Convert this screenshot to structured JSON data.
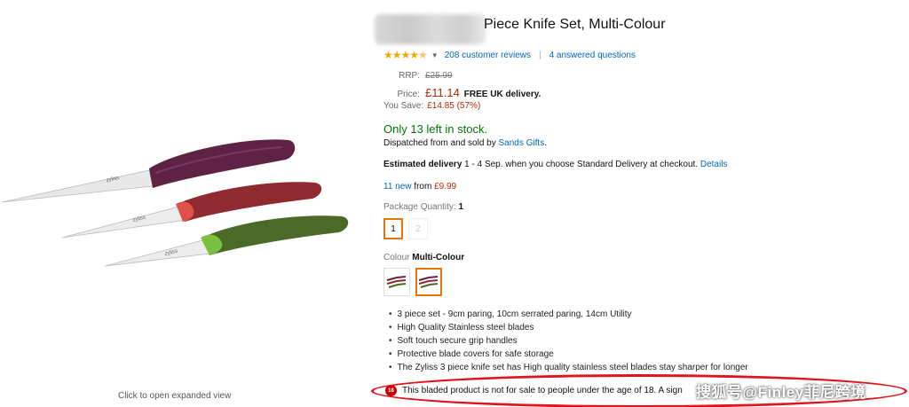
{
  "product": {
    "title": "Piece Knife Set, Multi-Colour",
    "rating": {
      "stars_value": 4.5,
      "reviews_label": "208 customer reviews",
      "questions_label": "4 answered questions"
    },
    "price": {
      "rrp_label": "RRP:",
      "rrp_value": "£25.99",
      "price_label": "Price:",
      "price_value": "£11.14",
      "delivery_note": "FREE UK delivery.",
      "save_label": "You Save:",
      "save_value": "£14.85 (57%)"
    },
    "stock": "Only 13 left in stock.",
    "dispatched_prefix": "Dispatched from and sold by",
    "seller": "Sands Gifts",
    "dispatched_suffix": ".",
    "delivery": {
      "label": "Estimated delivery",
      "text": " 1 - 4 Sep. when you choose Standard Delivery at checkout.",
      "details_link": "Details"
    },
    "offers": {
      "count_link": "11 new",
      "from_text": "from",
      "price": "£9.99"
    },
    "package_quantity": {
      "label": "Package Quantity:",
      "value": "1",
      "options": [
        "1",
        "2"
      ]
    },
    "colour": {
      "label": "Colour",
      "value": "Multi-Colour"
    },
    "bullets": [
      "3 piece set - 9cm paring, 10cm serrated paring, 14cm Utility",
      "High Quality Stainless steel blades",
      "Soft touch secure grip handles",
      "Protective blade covers for safe storage",
      "The Zyliss 3 piece knife set has High quality stainless steel blades stay sharper for longer"
    ],
    "warning": {
      "badge": "18",
      "text": "This bladed product is not for sale to people under the age of 18. A sign"
    },
    "expand_link": "Click to open expanded view",
    "knife_brand": "zyliss"
  },
  "watermark": "搜狐号@Finley菲尼跨境",
  "colors": {
    "price_red": "#b12704",
    "stock_green": "#007600",
    "link_blue": "#0066c0",
    "star_orange": "#f0a800",
    "select_orange": "#e77600",
    "highlight_red": "#e0141e",
    "handle_purple": "#5e2245",
    "handle_red": "#8e2a30",
    "handle_green": "#4b6a28"
  }
}
